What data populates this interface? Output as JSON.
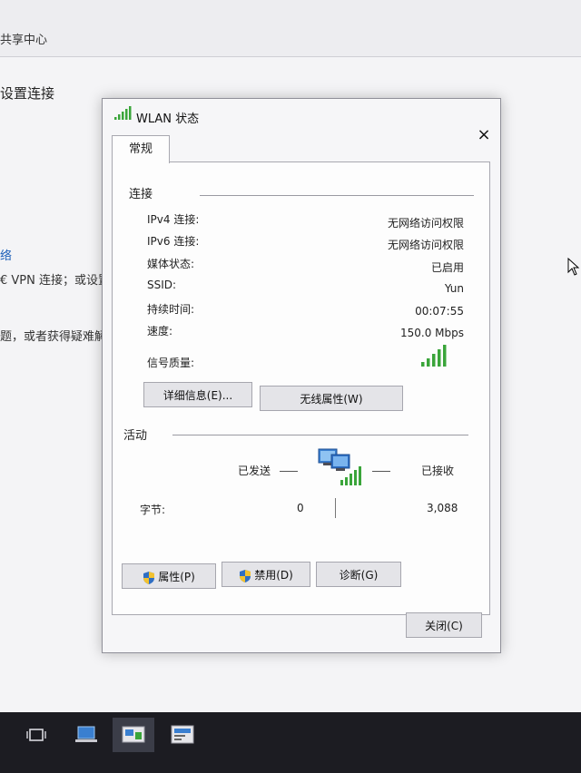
{
  "background": {
    "title": "共享中心",
    "heading": "设置连接",
    "link": "络",
    "line1": "€ VPN 连接；或设置",
    "line2": "题，或者获得疑难解"
  },
  "dialog": {
    "title": "WLAN 状态",
    "close_glyph": "×",
    "tab": "常规",
    "connection": {
      "section_title": "连接",
      "rows": [
        {
          "label": "IPv4 连接:",
          "value": "无网络访问权限"
        },
        {
          "label": "IPv6 连接:",
          "value": "无网络访问权限"
        },
        {
          "label": "媒体状态:",
          "value": "已启用"
        },
        {
          "label": "SSID:",
          "value": "Yun"
        },
        {
          "label": "持续时间:",
          "value": "00:07:55"
        },
        {
          "label": "速度:",
          "value": "150.0 Mbps"
        }
      ],
      "signal_label": "信号质量:",
      "signal_bars": 5,
      "details_button": "详细信息(E)...",
      "wireless_props_button": "无线属性(W)"
    },
    "activity": {
      "section_title": "活动",
      "sent_label": "已发送",
      "received_label": "已接收",
      "bytes_label": "字节:",
      "bytes_sent": "0",
      "bytes_received": "3,088"
    },
    "buttons": {
      "properties": "属性(P)",
      "disable": "禁用(D)",
      "diagnose": "诊断(G)",
      "close": "关闭(C)"
    }
  },
  "taskbar": {
    "items": [
      "task-view-icon",
      "network-app-icon",
      "network-center-icon",
      "wlan-status-icon"
    ]
  },
  "colors": {
    "accent_green": "#3aa53a",
    "dialog_bg": "#f6f6f8",
    "taskbar": "#1c1c22"
  }
}
